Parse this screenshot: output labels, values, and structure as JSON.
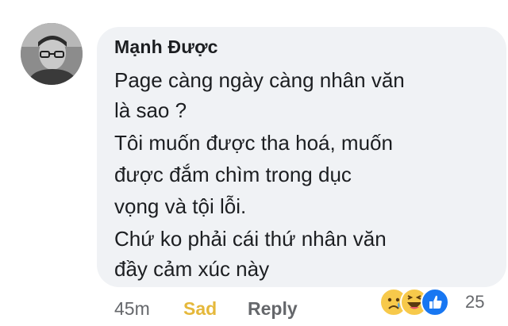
{
  "comment": {
    "author": "Mạnh Được",
    "lines": [
      "Page càng ngày càng nhân văn",
      "là sao ?",
      "Tôi muốn được tha hoá, muốn",
      "được đắm chìm trong dục",
      "vọng và tội lỗi.",
      "Chứ ko phải cái thứ nhân văn",
      "đầy cảm xúc này"
    ]
  },
  "footer": {
    "time": "45m",
    "reaction_label": "Sad",
    "reply_label": "Reply",
    "reaction_count": "25",
    "reaction_icons": [
      "sad-icon",
      "haha-icon",
      "like-icon"
    ],
    "colors": {
      "sad": "#e5b83b",
      "like": "#1877f2",
      "bubble": "#f0f2f5",
      "meta": "#65676b"
    }
  }
}
